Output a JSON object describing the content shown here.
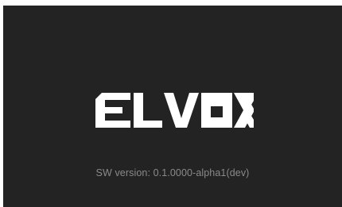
{
  "splash": {
    "logo_text": "ELVOX",
    "version_label": "SW version: 0.1.0000-alpha1(dev)"
  },
  "colors": {
    "background": "#232323",
    "logo": "#ffffff",
    "version_text": "#8a8a8a"
  },
  "icons": {
    "logo": "elvox-logo"
  }
}
